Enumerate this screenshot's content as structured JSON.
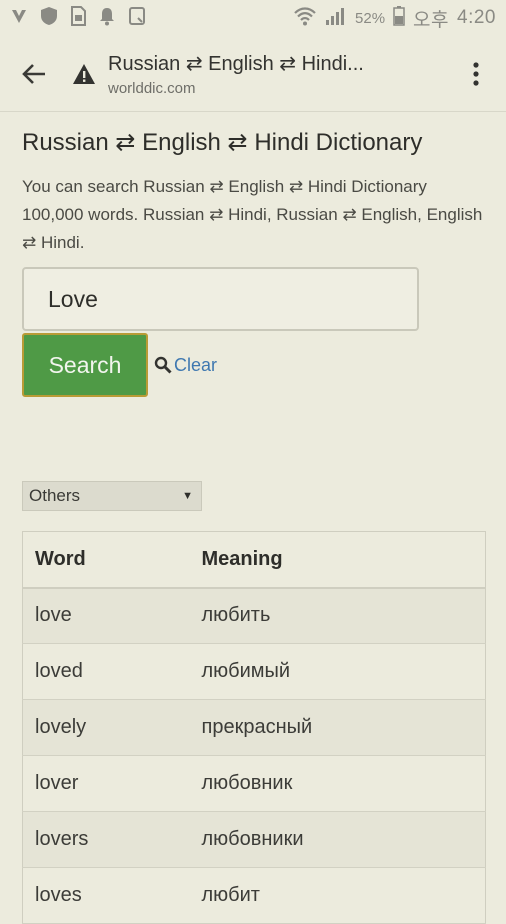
{
  "status_bar": {
    "battery": "52%",
    "time_prefix": "오후",
    "time": "4:20"
  },
  "toolbar": {
    "page_title": "Russian ⇄ English ⇄ Hindi...",
    "domain": "worlddic.com"
  },
  "page": {
    "heading": "Russian ⇄ English ⇄ Hindi Dictionary",
    "description": "You can search Russian ⇄ English ⇄ Hindi Dictionary 100,000 words. Russian ⇄ Hindi, Russian ⇄ English, English ⇄ Hindi.",
    "search_value": "Love",
    "search_button": "Search",
    "clear_link": "Clear",
    "dropdown_selected": "Others"
  },
  "results": {
    "headers": [
      "Word",
      "Meaning"
    ],
    "rows": [
      {
        "word": "love",
        "meaning": "любить"
      },
      {
        "word": "loved",
        "meaning": "любимый"
      },
      {
        "word": "lovely",
        "meaning": "прекрасный"
      },
      {
        "word": "lover",
        "meaning": "любовник"
      },
      {
        "word": "lovers",
        "meaning": "любовники"
      },
      {
        "word": "loves",
        "meaning": "любит"
      }
    ]
  },
  "colors": {
    "background": "#ecebdd",
    "search_button": "#4f9a46",
    "link": "#3f78b0"
  }
}
